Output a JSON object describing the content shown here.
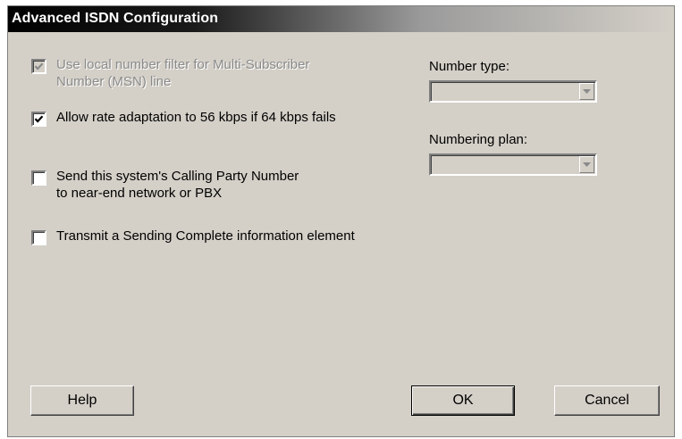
{
  "dialog": {
    "title": "Advanced ISDN Configuration"
  },
  "options": {
    "msn_filter": {
      "label": "Use local number filter for Multi-Subscriber\nNumber (MSN) line",
      "checked": true,
      "enabled": false
    },
    "rate_adaptation": {
      "label": "Allow rate adaptation to 56 kbps if 64 kbps fails",
      "checked": true,
      "enabled": true
    },
    "calling_party": {
      "label": "Send this system's Calling Party Number\nto near-end network or PBX",
      "checked": false,
      "enabled": true
    },
    "sending_complete": {
      "label": "Transmit a Sending Complete information element",
      "checked": false,
      "enabled": true
    }
  },
  "number_type": {
    "label": "Number type:",
    "value": "",
    "enabled": false
  },
  "numbering_plan": {
    "label": "Numbering plan:",
    "value": "",
    "enabled": false
  },
  "buttons": {
    "help": "Help",
    "ok": "OK",
    "cancel": "Cancel"
  },
  "icons": {
    "checkmark": "checkmark-icon",
    "dropdown": "chevron-down-icon"
  },
  "colors": {
    "dialog_bg": "#d4d0c8",
    "title_text": "#ffffff",
    "disabled_text": "#8a8a8a"
  }
}
